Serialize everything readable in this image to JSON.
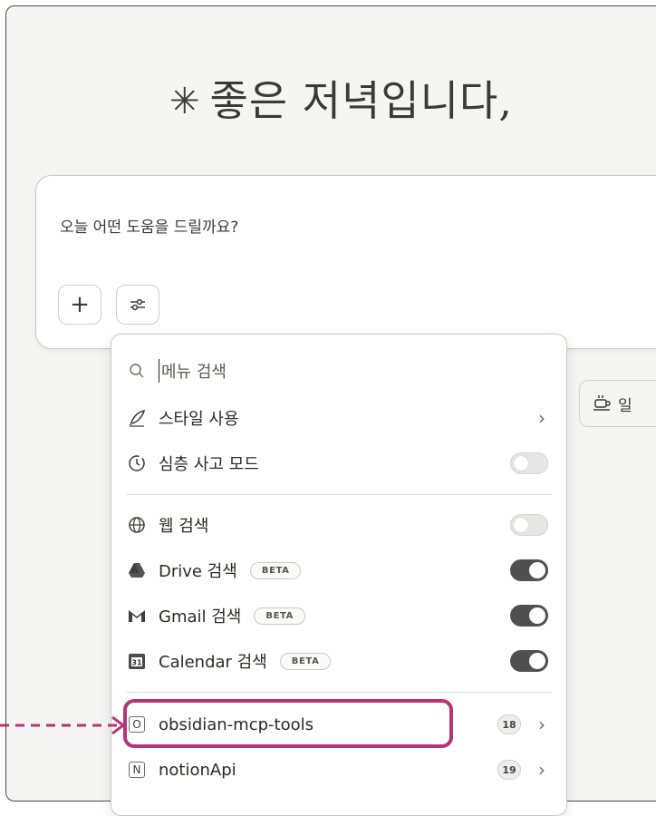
{
  "greeting": {
    "spark": "✳",
    "text": "좋은 저녁입니다, "
  },
  "input": {
    "placeholder": "오늘 어떤 도움을 드릴까요?"
  },
  "buttons": {
    "add": "+",
    "tools": "tools"
  },
  "chip": {
    "label": "일"
  },
  "menu": {
    "search_placeholder": "메뉴 검색",
    "items": [
      {
        "label": "스타일 사용",
        "icon": "quill-icon",
        "control": "chevron"
      },
      {
        "label": "심층 사고 모드",
        "icon": "clock-icon",
        "control": "toggle-off"
      },
      {
        "label": "웹 검색",
        "icon": "globe-icon",
        "control": "toggle-off"
      },
      {
        "label": "Drive 검색",
        "badge": "BETA",
        "icon": "drive-icon",
        "control": "toggle-on"
      },
      {
        "label": "Gmail 검색",
        "badge": "BETA",
        "icon": "gmail-icon",
        "control": "toggle-on"
      },
      {
        "label": "Calendar 검색",
        "badge": "BETA",
        "icon": "calendar-icon",
        "calendar_day": "31",
        "control": "toggle-on"
      }
    ],
    "integrations": [
      {
        "letter": "O",
        "label": "obsidian-mcp-tools",
        "count": "18"
      },
      {
        "letter": "N",
        "label": "notionApi",
        "count": "19"
      }
    ]
  },
  "colors": {
    "highlight": "#b8337a",
    "toggle_on": "#505050",
    "toggle_off": "#e6e6e3"
  }
}
